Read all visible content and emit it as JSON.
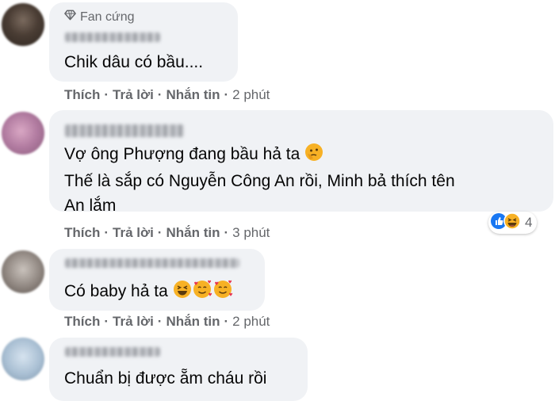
{
  "badge": {
    "label": "Fan cứng"
  },
  "actions": {
    "like": "Thích",
    "reply": "Trả lời",
    "message": "Nhắn tin",
    "sep": "·"
  },
  "comments": [
    {
      "lines": [
        "Chik dâu có bầu...."
      ],
      "time": "2 phút"
    },
    {
      "lines": [
        "Vợ ông Phượng đang bầu hả ta",
        "Thế là sắp có Nguyễn Công An rồi, Minh bả thích tên",
        "An lắm"
      ],
      "time": "3 phút",
      "reaction_count": "4"
    },
    {
      "lines": [
        "Có baby hả ta"
      ],
      "time": "2 phút"
    },
    {
      "lines": [
        "Chuẩn bị được ẵm cháu rồi"
      ]
    }
  ],
  "colors": {
    "bubble": "#f0f2f5",
    "secondary_text": "#65676b",
    "like_blue": "#1877f2",
    "haha_yellow": "#f7b125"
  }
}
